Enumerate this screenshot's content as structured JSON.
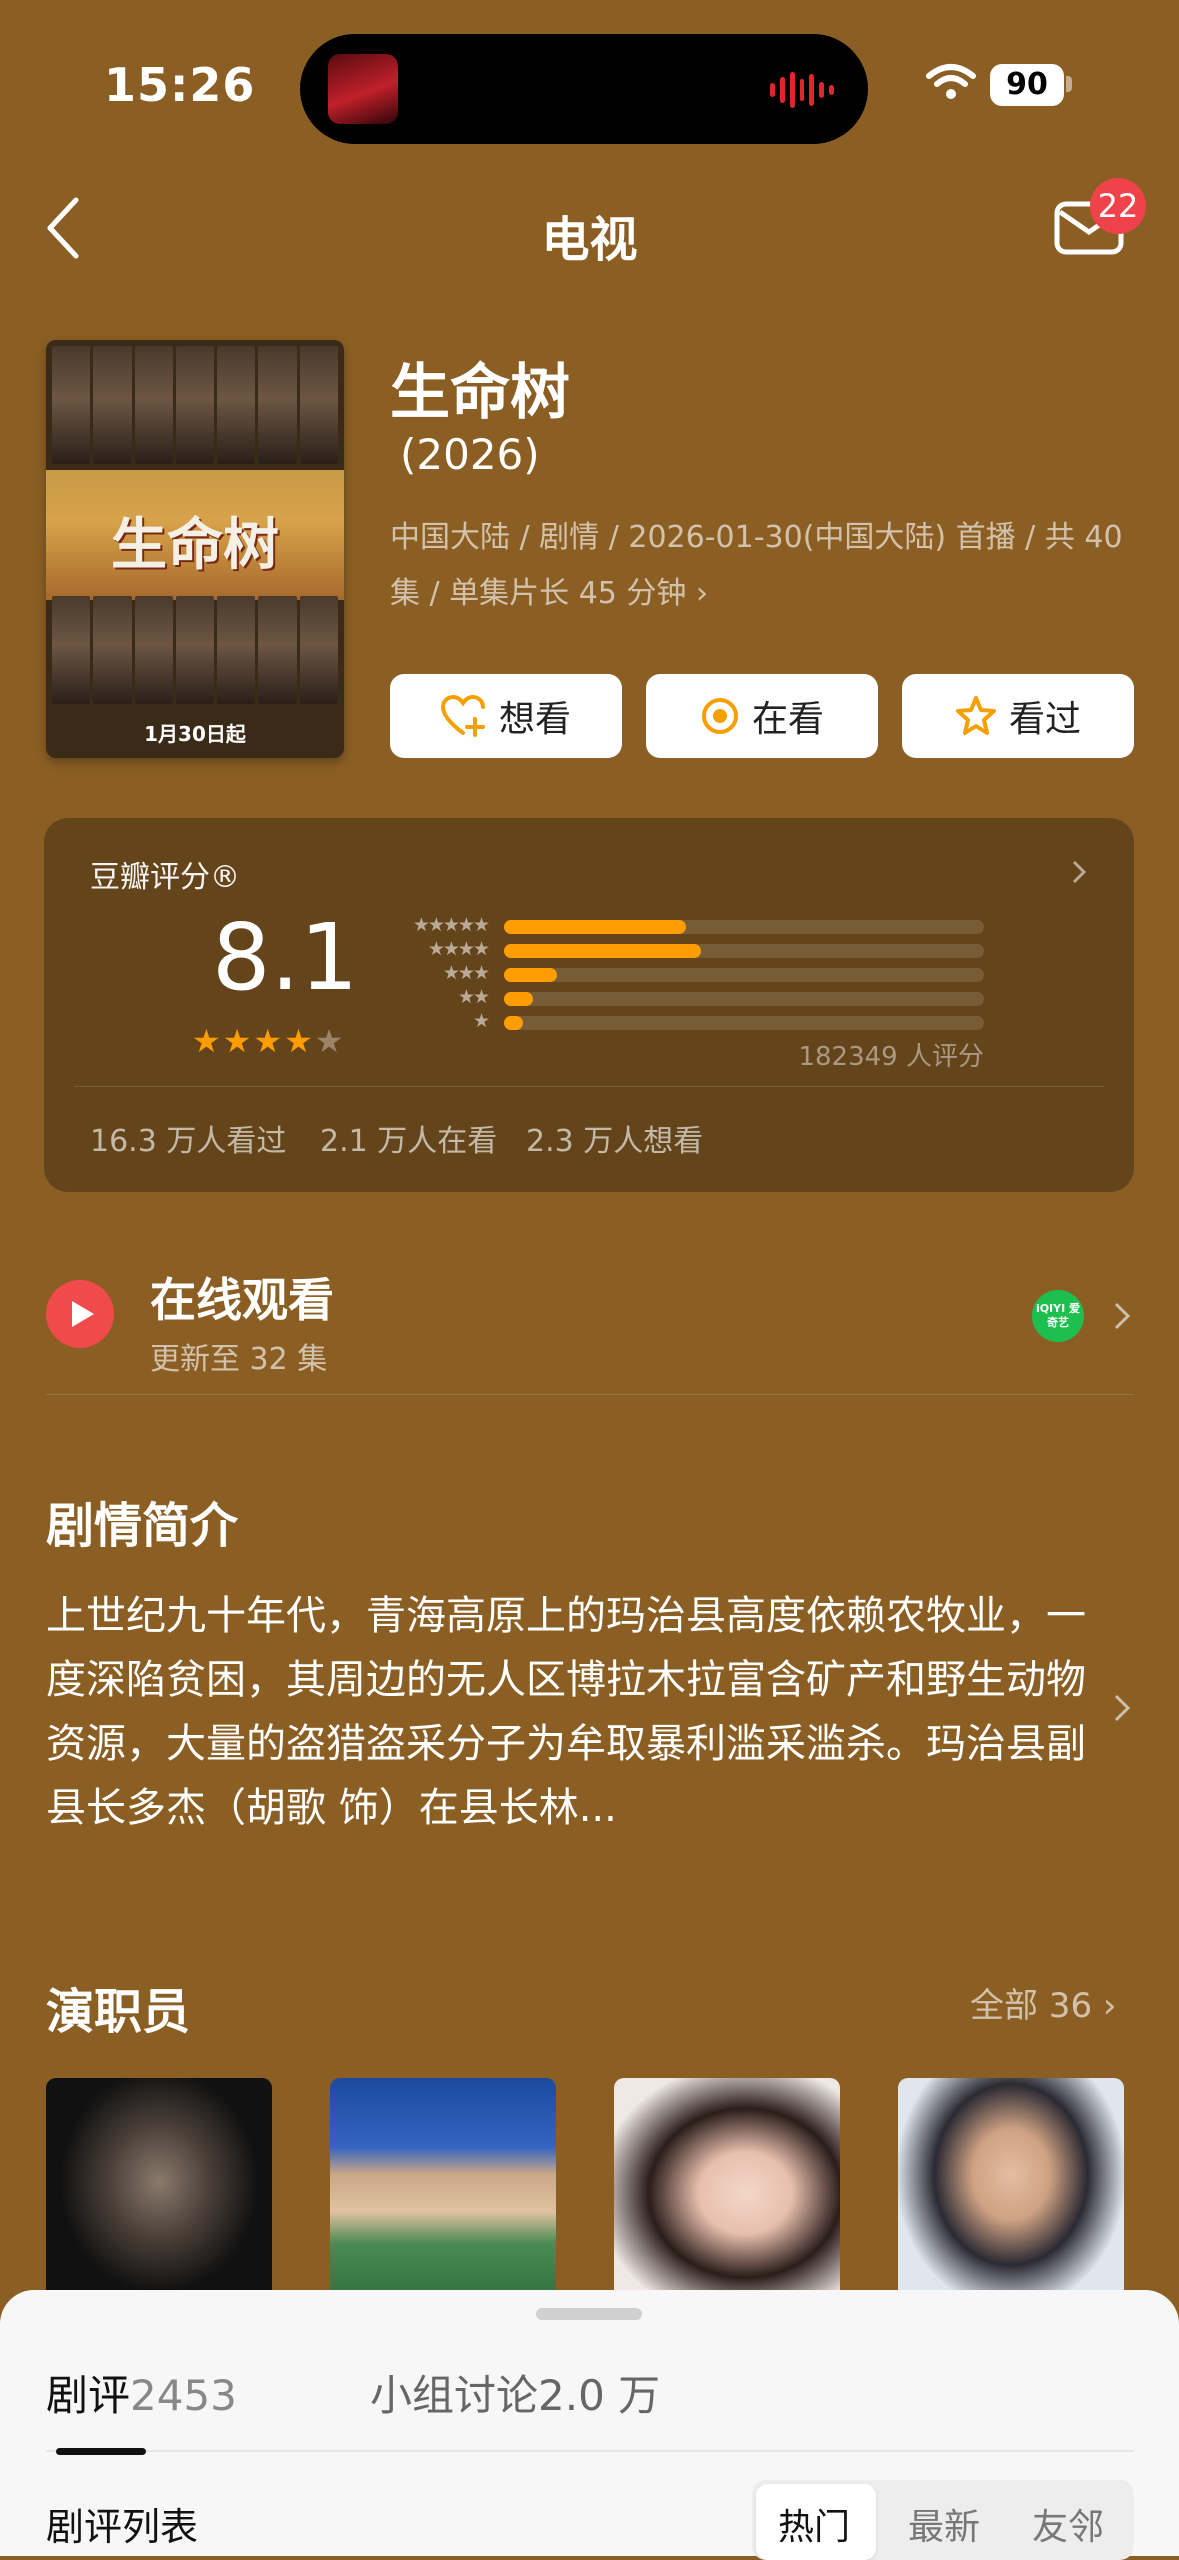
{
  "status_bar": {
    "time": "15:26",
    "battery": "90"
  },
  "nav": {
    "title": "电视",
    "mail_badge": "22"
  },
  "poster": {
    "title_art": "生命树",
    "date_text": "1月30日起"
  },
  "show": {
    "title": "生命树",
    "year": "(2026)",
    "meta": "中国大陆 / 剧情 / 2026-01-30(中国大陆) 首播 / 共 40 集 / 单集片长 45 分钟"
  },
  "actions": [
    {
      "label": "想看",
      "icon": "heart-plus-icon"
    },
    {
      "label": "在看",
      "icon": "target-circle-icon"
    },
    {
      "label": "看过",
      "icon": "star-outline-icon"
    }
  ],
  "rating": {
    "label": "豆瓣评分®",
    "score": "8.1",
    "stars_filled": 4,
    "count_text": "182349 人评分",
    "distribution": [
      {
        "stars": 5,
        "percent": 38
      },
      {
        "stars": 4,
        "percent": 41
      },
      {
        "stars": 3,
        "percent": 11
      },
      {
        "stars": 2,
        "percent": 6
      },
      {
        "stars": 1,
        "percent": 4
      }
    ],
    "stats": {
      "watched": "16.3 万人看过",
      "watching": "2.1 万人在看",
      "wish": "2.3 万人想看"
    }
  },
  "online": {
    "title": "在线观看",
    "subtitle": "更新至 32 集",
    "provider_icon": "iqiyi-icon",
    "provider_text": "iQIYI 爱奇艺"
  },
  "synopsis": {
    "title": "剧情简介",
    "text": "上世纪九十年代，青海高原上的玛治县高度依赖农牧业，一度深陷贫困，其周边的无人区博拉木拉富含矿产和野生动物资源，大量的盗猎盗采分子为牟取暴利滥采滥杀。玛治县副县长多杰（胡歌 饰）在县长林..."
  },
  "cast": {
    "title": "演职员",
    "all_label": "全部 36"
  },
  "bottom_sheet": {
    "tabs": [
      {
        "label": "剧评",
        "count": "2453",
        "active": true
      },
      {
        "label": "小组讨论",
        "count": "2.0 万",
        "active": false
      }
    ],
    "list_title": "剧评列表",
    "sort_options": [
      "热门",
      "最新",
      "友邻"
    ]
  },
  "colors": {
    "background": "#8B5F24",
    "accent_orange": "#FF9D00",
    "badge_red": "#F0424A",
    "play_red": "#F04A4A"
  }
}
